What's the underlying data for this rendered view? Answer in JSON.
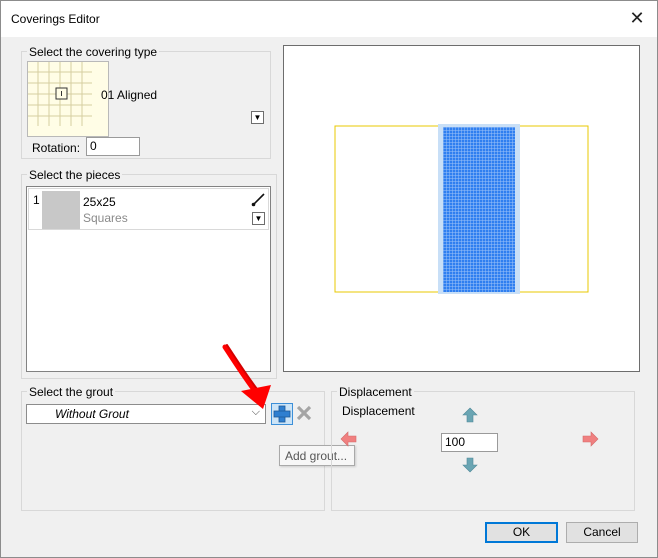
{
  "window": {
    "title": "Coverings Editor",
    "close_glyph": "✕"
  },
  "covering_type": {
    "label": "Select the covering type",
    "selected": "01 Aligned",
    "rotation_label": "Rotation:",
    "rotation_value": "0"
  },
  "pieces": {
    "label": "Select the pieces",
    "items": [
      {
        "index": "1",
        "name": "25x25",
        "type": "Squares"
      }
    ]
  },
  "grout": {
    "label": "Select the grout",
    "selected": "Without Grout",
    "add_tooltip": "Add grout..."
  },
  "displacement": {
    "group_label": "Displacement",
    "inner_label": "Displacement",
    "value": "100"
  },
  "buttons": {
    "ok": "OK",
    "cancel": "Cancel"
  },
  "colors": {
    "accent_blue": "#0078d7",
    "tile_fill": "#2f7ff0",
    "outline_yellow": "#e8c800",
    "annotation_red": "#ff0000"
  }
}
